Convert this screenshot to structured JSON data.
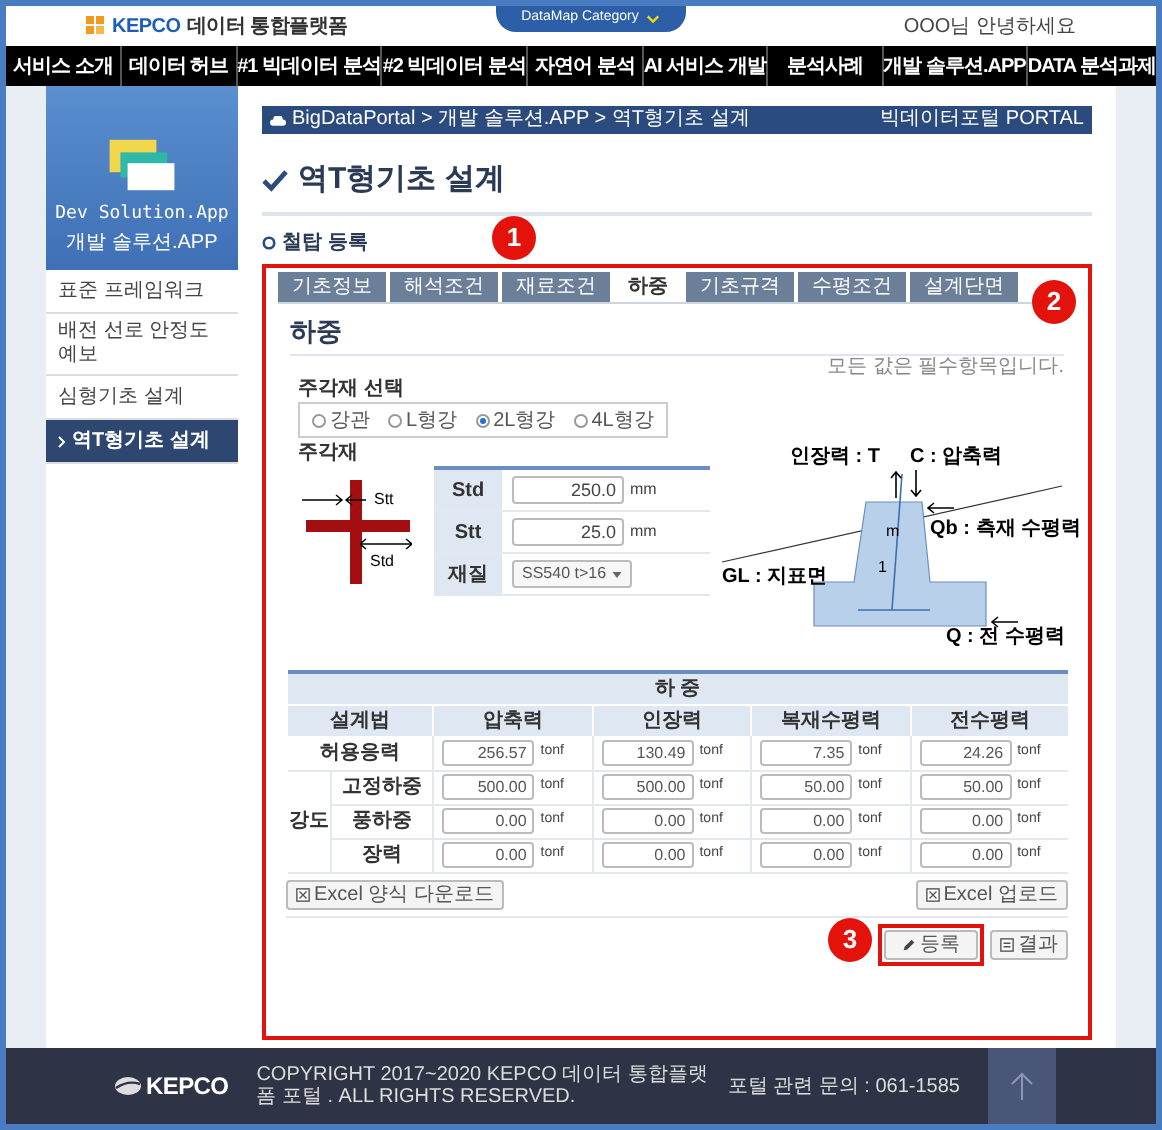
{
  "header": {
    "logo_brand": "KEPCO",
    "logo_text": "데이터 통합플랫폼",
    "category_tab": "DataMap Category",
    "greeting": "OOO님 안녕하세요"
  },
  "nav": [
    "서비스 소개",
    "데이터 허브",
    "#1 빅데이터 분석",
    "#2 빅데이터 분석",
    "자연어 분석",
    "AI 서비스 개발",
    "분석사례",
    "개발 솔루션.APP",
    "DATA 분석과제"
  ],
  "sidebar": {
    "banner_title": "Dev Solution.App",
    "banner_subtitle": "개발 솔루션.APP",
    "items": [
      {
        "label": "표준 프레임워크",
        "selected": false
      },
      {
        "label": "배전 선로 안정도 예보",
        "selected": false
      },
      {
        "label": "심형기초 설계",
        "selected": false
      },
      {
        "label": "역T형기초 설계",
        "selected": true
      }
    ]
  },
  "breadcrumb": {
    "path": "BigDataPortal > 개발 솔루션.APP > 역T형기초 설계",
    "brand": "빅데이터포털 PORTAL"
  },
  "page_title": "역T형기초 설계",
  "section_title": "철탑 등록",
  "tabs": [
    {
      "label": "기초정보",
      "selected": false
    },
    {
      "label": "해석조건",
      "selected": false
    },
    {
      "label": "재료조건",
      "selected": false
    },
    {
      "label": "하중",
      "selected": true
    },
    {
      "label": "기초규격",
      "selected": false
    },
    {
      "label": "수평조건",
      "selected": false
    },
    {
      "label": "설계단면",
      "selected": false
    }
  ],
  "panel": {
    "heading": "하중",
    "note": "모든 값은 필수항목입니다.",
    "member_select": {
      "label": "주각재 선택",
      "options": [
        {
          "label": "강관",
          "selected": false
        },
        {
          "label": "L형강",
          "selected": false
        },
        {
          "label": "2L형강",
          "selected": true
        },
        {
          "label": "4L형강",
          "selected": false
        }
      ]
    },
    "member": {
      "label": "주각재",
      "section_labels": [
        "Stt",
        "Std"
      ],
      "dims": [
        {
          "label": "Std",
          "value": "250.0",
          "unit": "mm"
        },
        {
          "label": "Stt",
          "value": "25.0",
          "unit": "mm"
        }
      ],
      "material": {
        "label": "재질",
        "value": "SS540 t>16"
      }
    },
    "diagram_labels": {
      "tension": "인장력 : T",
      "compression": "C : 압축력",
      "side": "Qb : 측재 수평력",
      "ground": "GL : 지표면",
      "slope_m": "m",
      "slope_1": "1",
      "total": "Q : 전 수평력"
    },
    "load_table": {
      "title": "하 중",
      "columns": [
        "설계법",
        "압축력",
        "인장력",
        "복재수평력",
        "전수평력"
      ],
      "rows": [
        {
          "cells": [
            "허용응력",
            {
              "value": "256.57",
              "unit": "tonf"
            },
            {
              "value": "130.49",
              "unit": "tonf"
            },
            {
              "value": "7.35",
              "unit": "tonf"
            },
            {
              "value": "24.26",
              "unit": "tonf"
            }
          ]
        }
      ],
      "group": {
        "label": "강도",
        "rows": [
          {
            "cells": [
              "고정하중",
              {
                "value": "500.00",
                "unit": "tonf"
              },
              {
                "value": "500.00",
                "unit": "tonf"
              },
              {
                "value": "50.00",
                "unit": "tonf"
              },
              {
                "value": "50.00",
                "unit": "tonf"
              }
            ]
          },
          {
            "cells": [
              "풍하중",
              {
                "value": "0.00",
                "unit": "tonf"
              },
              {
                "value": "0.00",
                "unit": "tonf"
              },
              {
                "value": "0.00",
                "unit": "tonf"
              },
              {
                "value": "0.00",
                "unit": "tonf"
              }
            ]
          },
          {
            "cells": [
              "장력",
              {
                "value": "0.00",
                "unit": "tonf"
              },
              {
                "value": "0.00",
                "unit": "tonf"
              },
              {
                "value": "0.00",
                "unit": "tonf"
              },
              {
                "value": "0.00",
                "unit": "tonf"
              }
            ]
          }
        ]
      }
    },
    "excel_download": "Excel 양식 다운로드",
    "excel_upload": "Excel 업로드",
    "register": "등록",
    "result": "결과"
  },
  "annotations": [
    "1",
    "2",
    "3"
  ],
  "footer": {
    "logo": "KEPCO",
    "copyright": "COPYRIGHT 2017~2020 KEPCO 데이터 통합플랫폼 포털 . ALL RIGHTS RESERVED.",
    "contact": "포털 관련 문의 : 061-1585"
  }
}
